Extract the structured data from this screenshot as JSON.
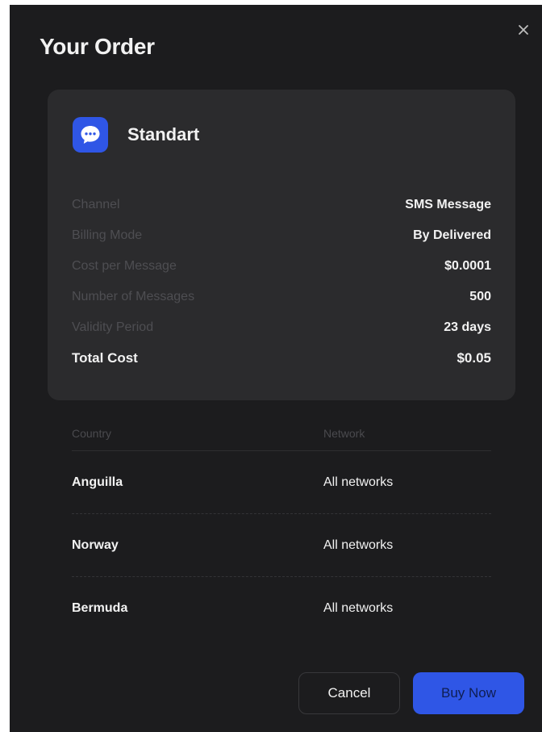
{
  "modal": {
    "title": "Your Order",
    "close_icon": "close-icon"
  },
  "plan": {
    "icon": "chat-bubble-icon",
    "name": "Standart"
  },
  "details": [
    {
      "label": "Channel",
      "value": "SMS Message"
    },
    {
      "label": "Billing Mode",
      "value": "By Delivered"
    },
    {
      "label": "Cost per Message",
      "value": "$0.0001"
    },
    {
      "label": "Number of Messages",
      "value": "500"
    },
    {
      "label": "Validity Period",
      "value": "23 days"
    }
  ],
  "total": {
    "label": "Total Cost",
    "value": "$0.05"
  },
  "table": {
    "headers": {
      "country": "Country",
      "network": "Network"
    },
    "rows": [
      {
        "country": "Anguilla",
        "network": "All networks"
      },
      {
        "country": "Norway",
        "network": "All networks"
      },
      {
        "country": "Bermuda",
        "network": "All networks"
      }
    ]
  },
  "actions": {
    "cancel_label": "Cancel",
    "buy_label": "Buy Now"
  },
  "colors": {
    "modal_bg": "#1c1c1e",
    "card_bg": "#2b2b2d",
    "accent": "#2f56e6"
  }
}
